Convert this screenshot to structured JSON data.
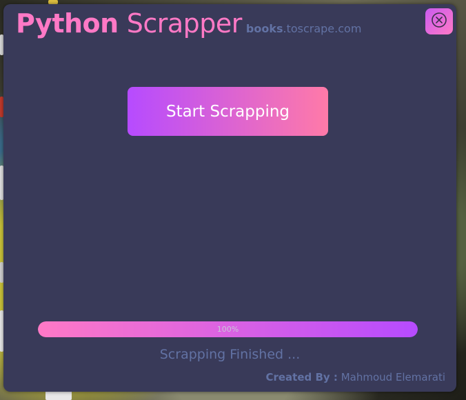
{
  "app": {
    "title_bold": "Python",
    "title_light": "Scrapper",
    "site_bold": "books",
    "site_rest": ".toscrape.com"
  },
  "controls": {
    "close_icon": "close-circle-icon",
    "start_label": "Start Scrapping"
  },
  "progress": {
    "value": 100,
    "label": "100%"
  },
  "status": {
    "text": "Scrapping Finished ..."
  },
  "footer": {
    "created_by_label": "Created By :",
    "author": "Mahmoud Elemarati"
  },
  "colors": {
    "window_bg": "#393a59",
    "accent_pink": "#ff79c6",
    "accent_purple": "#b64bff",
    "muted_text": "#6272a4"
  }
}
